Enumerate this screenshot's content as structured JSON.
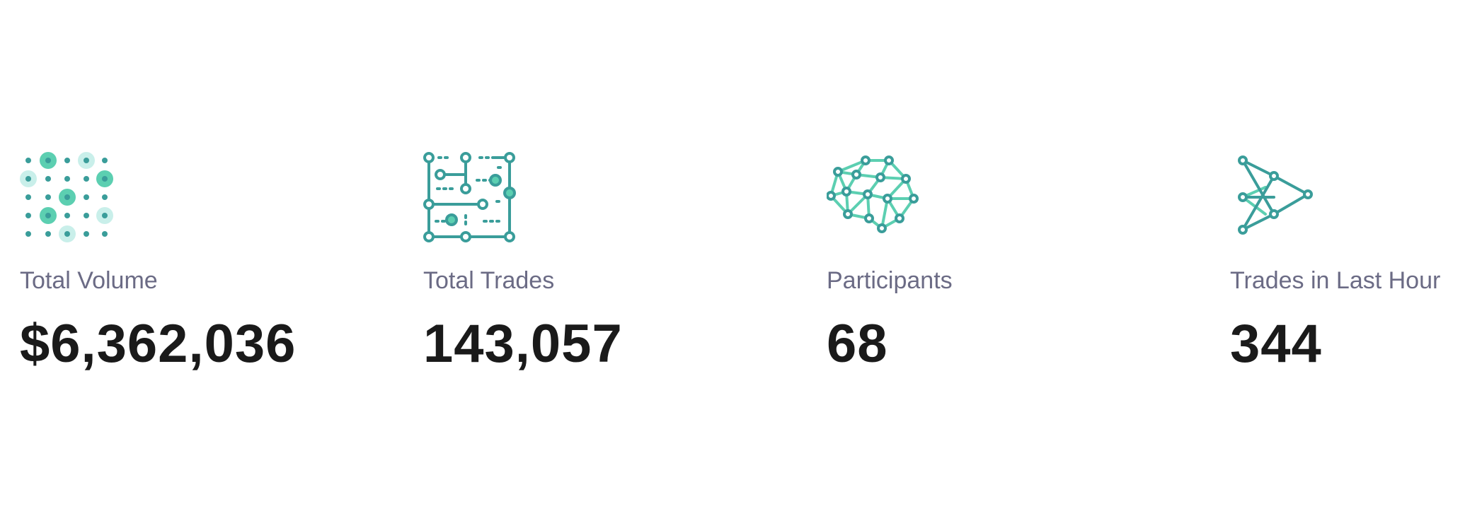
{
  "colors": {
    "accent_dark": "#3a9d9a",
    "accent_mid": "#5ccfb1",
    "accent_light": "#c9efea",
    "label": "#6b6b85",
    "value": "#1a1a1a"
  },
  "stats": [
    {
      "icon": "dot-grid-icon",
      "label": "Total Volume",
      "value": "$6,362,036"
    },
    {
      "icon": "circuit-icon",
      "label": "Total Trades",
      "value": "143,057"
    },
    {
      "icon": "network-icon",
      "label": "Participants",
      "value": "68"
    },
    {
      "icon": "arrow-graph-icon",
      "label": "Trades in Last Hour",
      "value": "344"
    }
  ]
}
